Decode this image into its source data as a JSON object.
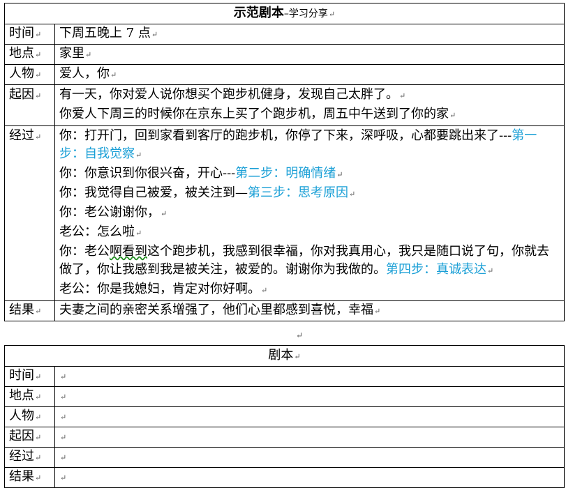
{
  "mark": "↵",
  "demo": {
    "title_main": "示范剧本",
    "title_sub": "–学习分享",
    "time": {
      "label": "时间",
      "value": "下周五晚上 7 点"
    },
    "place": {
      "label": "地点",
      "value": "家里"
    },
    "people": {
      "label": "人物",
      "value": "爱人，你"
    },
    "cause": {
      "label": "起因",
      "line1": "有一天，你对爱人说你想买个跑步机健身，发现自己太胖了。",
      "line2": "你爱人下周三的时候你在京东上买了个跑步机，周五中午送到了你的家"
    },
    "process": {
      "label": "经过",
      "p1_text": "你：打开门，回到家看到客厅的跑步机，你停了下来，深呼吸，心都要跳出来了---",
      "p1_step": "第一步：自我觉察",
      "p2_text": "你：你意识到你很兴奋，开心---",
      "p2_step": "第二步：明确情绪",
      "p3_text": "你：我觉得自己被爱，被关注到—",
      "p3_step": "第三步：思考原因",
      "p4_text": "你：老公谢谢你，",
      "p5_text": "老公：怎么啦",
      "p6_a": "你：老公",
      "p6_b": "啊看到",
      "p6_c": "这个跑步机，我感到很幸福，你对我真用心，我只是随口说了句，你就去做了，你让我感到我是被关注，被爱的。谢谢你为我做的。",
      "p6_step": "第四步：真诚表达",
      "p7_text": "老公：你是我媳妇，肯定对你好啊。"
    },
    "result": {
      "label": "结果",
      "value": "夫妻之间的亲密关系增强了，他们心里都感到喜悦，幸福"
    }
  },
  "blank": {
    "title": "剧本",
    "rows": [
      "时间",
      "地点",
      "人物",
      "起因",
      "经过",
      "结果"
    ]
  }
}
